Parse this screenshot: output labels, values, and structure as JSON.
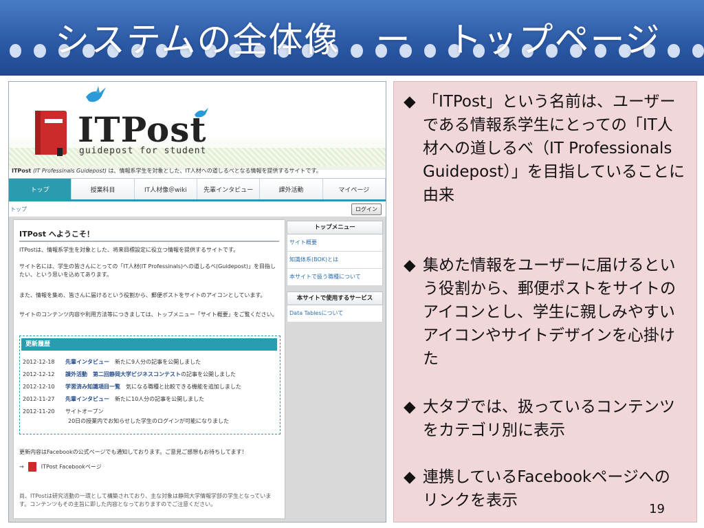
{
  "slide": {
    "title": "システムの全体像　ー　トップページ",
    "page_number": "19"
  },
  "site": {
    "logo_text": "ITPost",
    "logo_sub": "guidepost for student",
    "tagline_bold": "ITPost",
    "tagline_italic": "(IT Professinals Guidepost)",
    "tagline_rest": " は、情報系学生を対象とした、IT人材への道しるべとなる情報を提供するサイトです。",
    "nav": [
      "トップ",
      "授業科目",
      "IT人材像＠wiki",
      "先輩インタビュー",
      "課外活動",
      "マイページ"
    ],
    "breadcrumb": "トップ",
    "login": "ログイン",
    "welcome_title": "ITPost へようこそ！",
    "paragraphs": [
      "ITPostは、情報系学生を対象とした、将来目標設定に役立つ情報を提供するサイトです。",
      "サイト名には、学生の皆さんにとっての「IT人材(IT Professinals)への道しるべ(Guidepost)」を目指したい、という思いを込めてあります。",
      "また、情報を集め、皆さんに届けるという役割から、郵便ポストをサイトのアイコンとしています。",
      "サイトのコンテンツ内容や利用方法等につきましては、トップメニュー「サイト概要」をご覧ください。"
    ],
    "update": {
      "heading": "更新履歴",
      "items": [
        {
          "date": "2012-12-18",
          "link": "先輩インタビュー",
          "text": "　新たに9人分の記事を公開しました"
        },
        {
          "date": "2012-12-12",
          "link": "課外活動　第二回静岡大学ビジネスコンテスト",
          "text": "の記事を公開しました"
        },
        {
          "date": "2012-12-10",
          "link": "学習済み知識項目一覧",
          "text": "　気になる職種と比較できる機能を追加しました"
        },
        {
          "date": "2012-11-27",
          "link": "先輩インタビュー",
          "text": "　新たに10人分の記事を公開しました"
        },
        {
          "date": "2012-11-20",
          "link": "",
          "text": "サイトオープン"
        }
      ],
      "sub_text": "20日の授業内でお知らせした学生のログインが可能になりました"
    },
    "fb_note": "更新内容はFacebookの公式ページでも通知しております。ご意見ご感想もお待ちしてます！",
    "fb_arrow": "→",
    "fb_link": "ITPost Facebookページ",
    "foot_note": "尚、ITPostは研究活動の一環として構築されており、主な対象は静岡大学情報学部の学生となっています。コンテンツもその主旨に即した内容となっておりますのでご注意ください。",
    "side": {
      "menu_head": "トップメニュー",
      "menu_items": [
        "サイト概要",
        "知識体系(BOK)とは",
        "本サイトで扱う職種について"
      ],
      "service_head": "本サイトで使用するサービス",
      "service_items": [
        "Data Tablesについて"
      ]
    }
  },
  "notes": [
    "「ITPost」という名前は、ユーザーである情報系学生にとっての「IT人材への道しるべ（IT Professionals Guidepost）」を目指していることに由来",
    "集めた情報をユーザーに届けるという役割から、郵便ポストをサイトのアイコンとし、学生に親しみやすいアイコンやサイトデザインを心掛けた",
    "大タブでは、扱っているコンテンツをカテゴリ別に表示",
    "連携しているFacebookページへのリンクを表示"
  ],
  "bullet_mark": "◆",
  "colors": {
    "header_blue": "#2c5aa6",
    "teal": "#2b9bb0",
    "notes_pink": "#f2d7da",
    "logo_red": "#cc2b2b"
  }
}
